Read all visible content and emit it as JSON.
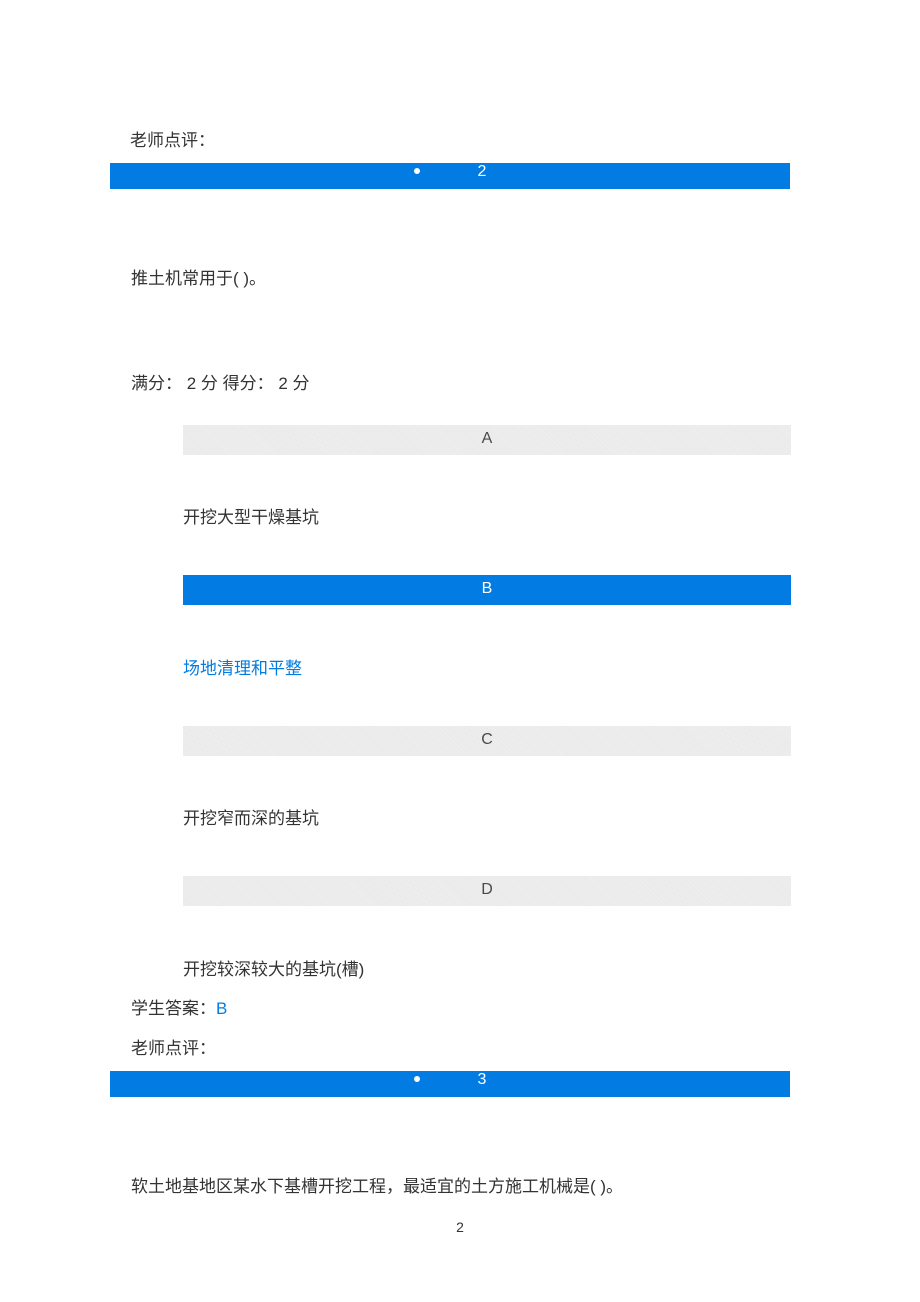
{
  "teacher_comment_label": "老师点评：",
  "question2": {
    "number": "2",
    "text": "推土机常用于( )。",
    "score_line": "满分： 2 分 得分： 2 分",
    "options": {
      "A": {
        "letter": "A",
        "text": "开挖大型干燥基坑"
      },
      "B": {
        "letter": "B",
        "text": "场地清理和平整"
      },
      "C": {
        "letter": "C",
        "text": "开挖窄而深的基坑"
      },
      "D": {
        "letter": "D",
        "text": "开挖较深较大的基坑(槽)"
      }
    },
    "student_answer_label": "学生答案：",
    "student_answer": "B"
  },
  "question3": {
    "number": "3",
    "text": "软土地基地区某水下基槽开挖工程，最适宜的土方施工机械是( )。"
  },
  "page_number": "2"
}
